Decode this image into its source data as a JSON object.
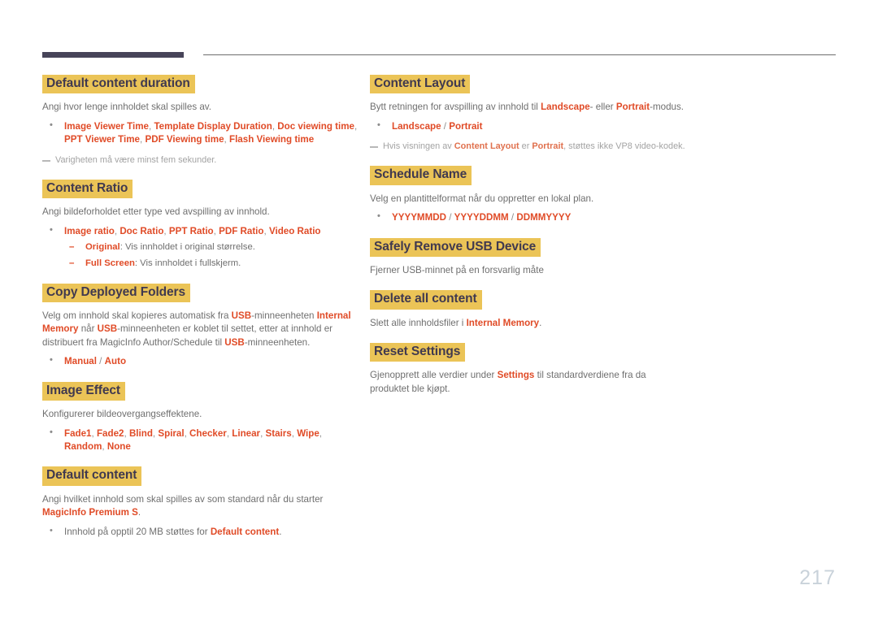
{
  "page": {
    "number": "217",
    "header_rule": "decorative-rule"
  },
  "left_column": {
    "sections": [
      {
        "heading": "Default content duration",
        "body": "Angi hvor lenge innholdet skal spilles av.",
        "bullets": [
          {
            "strong": true,
            "segments": [
              {
                "text": "Image Viewer Time",
                "style": "em"
              },
              {
                "text": ", ",
                "style": "sep"
              },
              {
                "text": "Template Display Duration",
                "style": "em"
              },
              {
                "text": ", ",
                "style": "sep"
              },
              {
                "text": "Doc viewing time",
                "style": "em"
              },
              {
                "text": ", ",
                "style": "sep"
              },
              {
                "text": "PPT Viewer Time",
                "style": "em"
              },
              {
                "text": ", ",
                "style": "sep"
              },
              {
                "text": "PDF Viewing time",
                "style": "em"
              },
              {
                "text": ", ",
                "style": "sep"
              },
              {
                "text": "Flash Viewing time",
                "style": "em"
              }
            ]
          }
        ],
        "note": [
          {
            "text": "Varigheten må være minst fem sekunder.",
            "style": "plain"
          }
        ]
      },
      {
        "heading": "Content Ratio",
        "body": "Angi bildeforholdet etter type ved avspilling av innhold.",
        "bullets": [
          {
            "strong": true,
            "segments": [
              {
                "text": "Image ratio",
                "style": "em"
              },
              {
                "text": ", ",
                "style": "sep"
              },
              {
                "text": "Doc Ratio",
                "style": "em"
              },
              {
                "text": ", ",
                "style": "sep"
              },
              {
                "text": "PPT Ratio",
                "style": "em"
              },
              {
                "text": ", ",
                "style": "sep"
              },
              {
                "text": "PDF Ratio",
                "style": "em"
              },
              {
                "text": ", ",
                "style": "sep"
              },
              {
                "text": "Video Ratio",
                "style": "em"
              }
            ],
            "subbullets": [
              {
                "segments": [
                  {
                    "text": "Original",
                    "style": "em"
                  },
                  {
                    "text": ": Vis innholdet i original størrelse.",
                    "style": "plain"
                  }
                ]
              },
              {
                "segments": [
                  {
                    "text": "Full Screen",
                    "style": "em"
                  },
                  {
                    "text": ": Vis innholdet i fullskjerm.",
                    "style": "plain"
                  }
                ]
              }
            ]
          }
        ]
      },
      {
        "heading": "Copy Deployed Folders",
        "body_segments": [
          {
            "text": "Velg om innhold skal kopieres automatisk fra ",
            "style": "plain"
          },
          {
            "text": "USB",
            "style": "em"
          },
          {
            "text": "-minneenheten ",
            "style": "plain"
          },
          {
            "text": "Internal Memory",
            "style": "em"
          },
          {
            "text": " når ",
            "style": "plain"
          },
          {
            "text": "USB",
            "style": "em"
          },
          {
            "text": "-minneenheten er koblet til settet, etter at innhold er distribuert fra MagicInfo Author/Schedule til ",
            "style": "plain"
          },
          {
            "text": "USB",
            "style": "em"
          },
          {
            "text": "-minneenheten.",
            "style": "plain"
          }
        ],
        "bullets": [
          {
            "strong": true,
            "segments": [
              {
                "text": "Manual",
                "style": "em"
              },
              {
                "text": " / ",
                "style": "sep"
              },
              {
                "text": "Auto",
                "style": "em"
              }
            ]
          }
        ]
      },
      {
        "heading": "Image Effect",
        "body": "Konfigurerer bildeovergangseffektene.",
        "bullets": [
          {
            "strong": true,
            "segments": [
              {
                "text": "Fade1",
                "style": "em"
              },
              {
                "text": ", ",
                "style": "sep"
              },
              {
                "text": "Fade2",
                "style": "em"
              },
              {
                "text": ", ",
                "style": "sep"
              },
              {
                "text": "Blind",
                "style": "em"
              },
              {
                "text": ", ",
                "style": "sep"
              },
              {
                "text": "Spiral",
                "style": "em"
              },
              {
                "text": ", ",
                "style": "sep"
              },
              {
                "text": "Checker",
                "style": "em"
              },
              {
                "text": ", ",
                "style": "sep"
              },
              {
                "text": "Linear",
                "style": "em"
              },
              {
                "text": ", ",
                "style": "sep"
              },
              {
                "text": "Stairs",
                "style": "em"
              },
              {
                "text": ", ",
                "style": "sep"
              },
              {
                "text": "Wipe",
                "style": "em"
              },
              {
                "text": ", ",
                "style": "sep"
              },
              {
                "text": "Random",
                "style": "em"
              },
              {
                "text": ", ",
                "style": "sep"
              },
              {
                "text": "None",
                "style": "em"
              }
            ]
          }
        ]
      },
      {
        "heading": "Default content",
        "body_segments": [
          {
            "text": "Angi hvilket innhold som skal spilles av som standard når du starter ",
            "style": "plain"
          },
          {
            "text": "MagicInfo Premium S",
            "style": "em"
          },
          {
            "text": ".",
            "style": "plain"
          }
        ],
        "bullets": [
          {
            "strong": false,
            "segments": [
              {
                "text": "Innhold på opptil 20 MB støttes for ",
                "style": "plain"
              },
              {
                "text": "Default content",
                "style": "em"
              },
              {
                "text": ".",
                "style": "plain"
              }
            ]
          }
        ]
      }
    ]
  },
  "right_column": {
    "sections": [
      {
        "heading": "Content Layout",
        "body_segments": [
          {
            "text": "Bytt retningen for avspilling av innhold til ",
            "style": "plain"
          },
          {
            "text": "Landscape",
            "style": "em"
          },
          {
            "text": "- eller ",
            "style": "plain"
          },
          {
            "text": "Portrait",
            "style": "em"
          },
          {
            "text": "-modus.",
            "style": "plain"
          }
        ],
        "bullets": [
          {
            "strong": true,
            "segments": [
              {
                "text": "Landscape",
                "style": "em"
              },
              {
                "text": " / ",
                "style": "sep"
              },
              {
                "text": "Portrait",
                "style": "em"
              }
            ]
          }
        ],
        "note": [
          {
            "text": "Hvis visningen av ",
            "style": "plain"
          },
          {
            "text": "Content Layout",
            "style": "em"
          },
          {
            "text": " er ",
            "style": "plain"
          },
          {
            "text": "Portrait",
            "style": "em"
          },
          {
            "text": ", støttes ikke VP8 video-kodek.",
            "style": "plain"
          }
        ]
      },
      {
        "heading": "Schedule Name",
        "body": "Velg en plantittelformat når du oppretter en lokal plan.",
        "bullets": [
          {
            "strong": true,
            "segments": [
              {
                "text": "YYYYMMDD",
                "style": "em"
              },
              {
                "text": " / ",
                "style": "sep"
              },
              {
                "text": "YYYYDDMM",
                "style": "em"
              },
              {
                "text": " / ",
                "style": "sep"
              },
              {
                "text": "DDMMYYYY",
                "style": "em"
              }
            ]
          }
        ]
      },
      {
        "heading": "Safely Remove USB Device",
        "body": "Fjerner USB-minnet på en forsvarlig måte"
      },
      {
        "heading": "Delete all content",
        "body_segments": [
          {
            "text": "Slett alle innholdsfiler i ",
            "style": "plain"
          },
          {
            "text": "Internal Memory",
            "style": "em"
          },
          {
            "text": ".",
            "style": "plain"
          }
        ]
      },
      {
        "heading": "Reset Settings",
        "body_segments": [
          {
            "text": "Gjenopprett alle verdier under ",
            "style": "plain"
          },
          {
            "text": "Settings",
            "style": "em"
          },
          {
            "text": " til standardverdiene fra da produktet ble kjøpt.",
            "style": "plain"
          }
        ]
      }
    ]
  },
  "colors": {
    "heading_highlight": "#ebc457",
    "heading_text": "#40394f",
    "emphasis": "#e04b27",
    "body_text": "#6f6f6f",
    "note_text": "#a3a3a3",
    "rule_dark": "#474459",
    "rule_thin": "#6d6d6d",
    "page_number": "#c9d2da"
  }
}
